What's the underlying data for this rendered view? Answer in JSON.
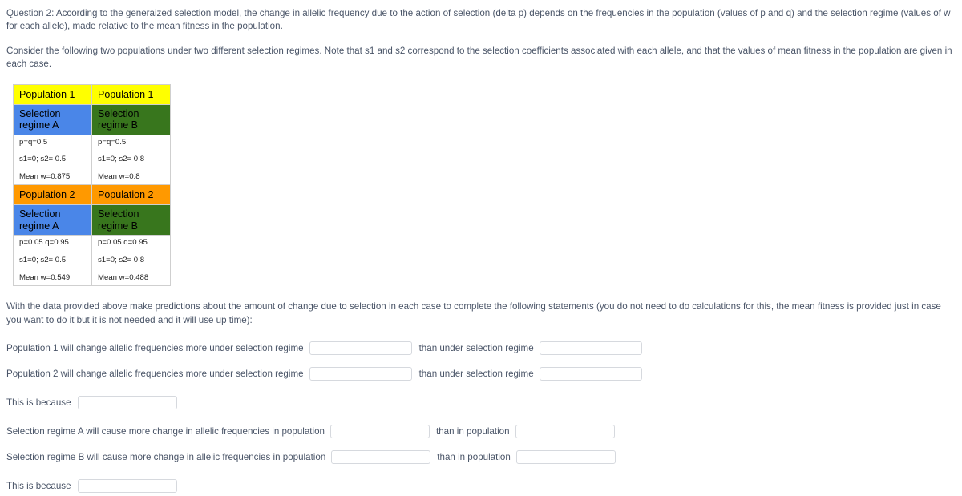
{
  "intro": {
    "paragraph_1": "Question 2: According to the generaized selection model, the change in allelic frequency due to the action of selection (delta p) depends on the frequencies in the population (values of p and q) and the selection regime (values of w for each allele), made relative to the mean fitness in the population.",
    "paragraph_2": "Consider the following two populations under two different selection regimes. Note that s1 and s2 correspond to the selection coefficients associated with each allele, and that the values of mean fitness in the population are given in each case."
  },
  "table": {
    "colors": {
      "population_1_header": "#ffff00",
      "population_2_header": "#ff9900",
      "regime_a": "#4a86e8",
      "regime_b": "#38761d",
      "cell_background": "#ffffff",
      "border": "#cfcfcf"
    },
    "blocks": [
      {
        "population_label_left": "Population 1",
        "population_label_right": "Population 1",
        "regime_left": "Selection regime A",
        "regime_right": "Selection regime B",
        "values_left": [
          "p=q=0.5",
          "s1=0; s2= 0.5",
          "Mean w=0.875"
        ],
        "values_right": [
          "p=q=0.5",
          "s1=0; s2= 0.8",
          "Mean w=0.8"
        ]
      },
      {
        "population_label_left": "Population 2",
        "population_label_right": "Population 2",
        "regime_left": "Selection regime A",
        "regime_right": "Selection regime B",
        "values_left": [
          "p=0.05 q=0.95",
          "s1=0; s2= 0.5",
          "Mean w=0.549"
        ],
        "values_right": [
          "p=0.05 q=0.95",
          "s1=0; s2= 0.8",
          "Mean w=0.488"
        ]
      }
    ]
  },
  "instructions": {
    "paragraph": "With the data provided above make predictions about the amount of change due to selection in each case to complete the following statements (you do not need to do calculations for this, the mean fitness is provided just in case you want to do it but it is not needed and it will use up time):"
  },
  "statements": {
    "row_1": {
      "lead_text": "Population 1 will change allelic frequencies more under selection regime",
      "mid_text": "than under selection regime",
      "answer_1": "",
      "answer_2": ""
    },
    "row_2": {
      "lead_text": "Population 2 will change allelic frequencies more under selection regime",
      "mid_text": "than under selection regime",
      "answer_1": "",
      "answer_2": ""
    },
    "row_3": {
      "lead_text": "This is because",
      "answer_1": ""
    },
    "row_4": {
      "lead_text": "Selection regime A will cause more change in allelic frequencies in population",
      "mid_text": "than in population",
      "answer_1": "",
      "answer_2": ""
    },
    "row_5": {
      "lead_text": "Selection regime B will cause more change in allelic frequencies in population",
      "mid_text": "than in population",
      "answer_1": "",
      "answer_2": ""
    },
    "row_6": {
      "lead_text": "This is because",
      "answer_1": ""
    }
  }
}
